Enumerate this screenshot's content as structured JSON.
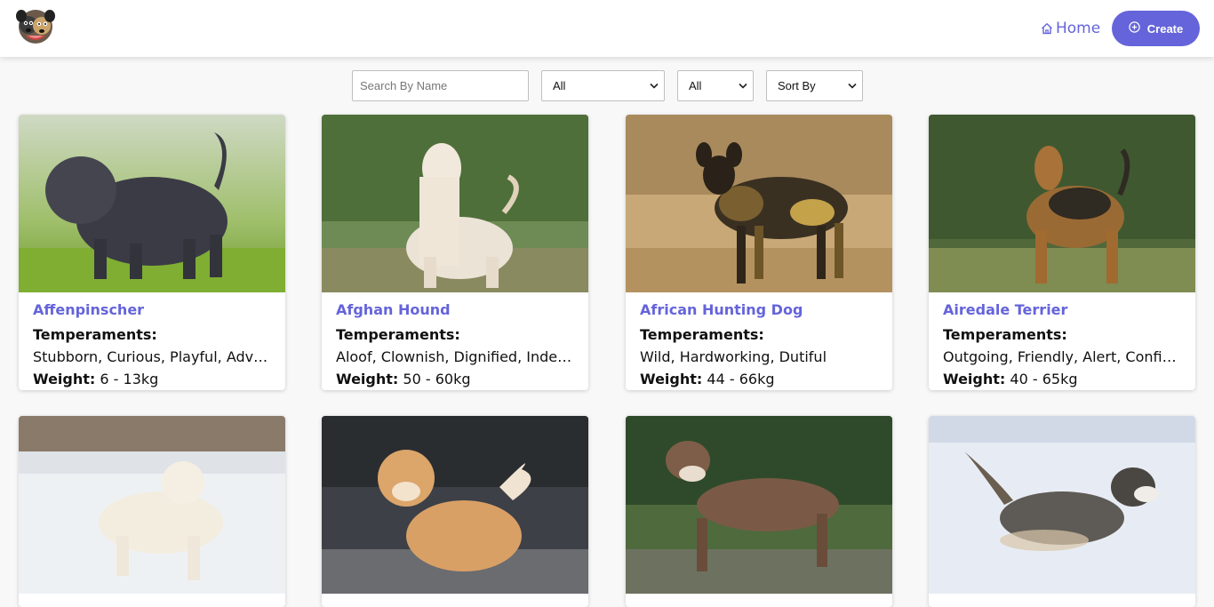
{
  "header": {
    "home_label": "Home",
    "create_label": "Create"
  },
  "filters": {
    "search_placeholder": "Search By Name",
    "temperament_select": "All",
    "origin_select": "All",
    "sort_select": "Sort By"
  },
  "card_labels": {
    "temperaments": "Temperaments:",
    "weight": "Weight:"
  },
  "dogs": [
    {
      "name": "Affenpinscher",
      "temperaments": "Stubborn, Curious, Playful, Adventurous, Active, Fun-loving",
      "weight": "6 - 13kg"
    },
    {
      "name": "Afghan Hound",
      "temperaments": "Aloof, Clownish, Dignified, Independent, Happy",
      "weight": "50 - 60kg"
    },
    {
      "name": "African Hunting Dog",
      "temperaments": "Wild, Hardworking, Dutiful",
      "weight": "44 - 66kg"
    },
    {
      "name": "Airedale Terrier",
      "temperaments": "Outgoing, Friendly, Alert, Confident, Intelligent, Courageous",
      "weight": "40 - 65kg"
    },
    {
      "name": "",
      "temperaments": "",
      "weight": ""
    },
    {
      "name": "",
      "temperaments": "",
      "weight": ""
    },
    {
      "name": "",
      "temperaments": "",
      "weight": ""
    },
    {
      "name": "",
      "temperaments": "",
      "weight": ""
    }
  ],
  "colors": {
    "accent": "#6564db",
    "background": "#f8f8f8"
  },
  "icons": {
    "home": "home-icon",
    "create": "plus-circle-icon",
    "logo": "dog-logo-icon"
  }
}
